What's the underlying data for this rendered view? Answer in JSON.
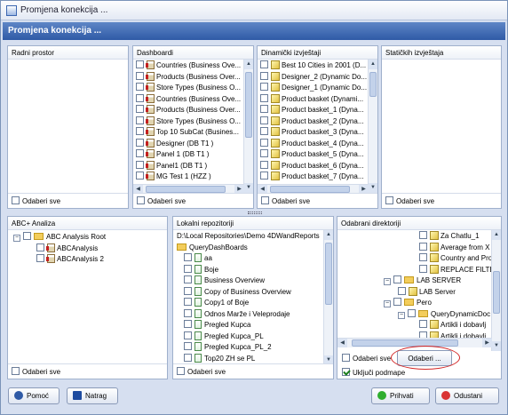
{
  "window": {
    "title": "Promjena konekcija ..."
  },
  "header": {
    "title": "Promjena konekcija ..."
  },
  "radni_prostor": {
    "title": "Radni prostor",
    "select_all": "Odaberi sve"
  },
  "dashboardi": {
    "title": "Dashboardi",
    "select_all": "Odaberi sve",
    "items": [
      "Countries (Business Ove...",
      "Products (Business Over...",
      "Store Types (Business O...",
      "Countries (Business Ove...",
      "Products (Business Over...",
      "Store Types (Business O...",
      "Top 10 SubCat (Busines...",
      "Designer (DB T1 )",
      "Panel 1 (DB T1 )",
      "Panel1 (DB T1 )",
      "MG Test 1 (HZZ )"
    ]
  },
  "dinamicki": {
    "title": "Dinamički izvještaji",
    "select_all": "Odaberi sve",
    "items": [
      "Best 10 Cities in 2001 (D...",
      "Designer_2 (Dynamic Do...",
      "Designer_1 (Dynamic Do...",
      "Product basket (Dynami...",
      "Product basket_1 (Dyna...",
      "Product basket_2 (Dyna...",
      "Product basket_3 (Dyna...",
      "Product basket_4 (Dyna...",
      "Product basket_5 (Dyna...",
      "Product basket_6 (Dyna...",
      "Product basket_7 (Dyna..."
    ]
  },
  "staticki": {
    "title": "Statičkih izvještaja",
    "select_all": "Odaberi sve"
  },
  "abc": {
    "title": "ABC+ Analiza",
    "select_all": "Odaberi sve",
    "root": "ABC Analysis Root",
    "children": [
      "ABCAnalysis",
      "ABCAnalysis 2"
    ]
  },
  "lokalni": {
    "title": "Lokalni repozitoriji",
    "select_all": "Odaberi sve",
    "path": "D:\\Local Repositories\\Demo 4DWandReports",
    "folder": "QueryDashBoards",
    "items": [
      "aa",
      "Boje",
      "Business Overview",
      "Copy of Business Overview",
      "Copy1 of Boje",
      "Odnos Marže i Veleprodaje",
      "Pregled Kupca",
      "Pregled Kupca_PL",
      "Pregled Kupca_PL_2",
      "Top20 ZH se PL"
    ]
  },
  "odabrani": {
    "title": "Odabrani direktoriji",
    "select_all": "Odaberi sve",
    "choose_button": "Odaberi ...",
    "include_sub": "Uključi podmape",
    "items": [
      "Za Chatlu_1",
      "Average from X",
      "Country and Produ",
      "REPLACE FILTER",
      "LAB SERVER",
      "LAB Server",
      "Pero",
      "QueryDynamicDoc",
      "Artikli i dobavlj",
      "Artikli i dobavlj"
    ]
  },
  "footer": {
    "help": "Pomoć",
    "back": "Natrag",
    "accept": "Prihvati",
    "cancel": "Odustani"
  },
  "colors": {
    "header": "#2f5aa6",
    "highlight": "#d32626",
    "accept_icon": "#2fae2f",
    "cancel_icon": "#d93434"
  }
}
